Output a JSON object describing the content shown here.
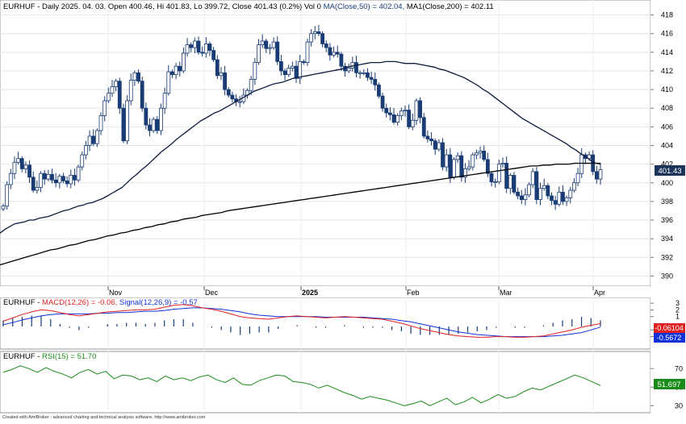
{
  "main": {
    "title_symbol": "EURHUF",
    "title_rest": " - Daily 2025. 04. 03. Open 400.46, Hi 401.83, Lo 399.72, Close 401.43 (0.2%) Vol 0",
    "title_ma50": "MA(Close,50) = 402.04,",
    "title_ma200": "MA1(Close,200) = 402.11",
    "price_badge": "401.43",
    "y_ticks": [
      "390",
      "392",
      "394",
      "396",
      "398",
      "400",
      "402",
      "404",
      "406",
      "408",
      "410",
      "412",
      "414",
      "416",
      "418"
    ],
    "x_labels": [
      "Nov",
      "Dec",
      "2025",
      "Feb",
      "Mar",
      "Apr"
    ]
  },
  "macd": {
    "title_symbol": "EURHUF",
    "title_macd": "MACD(12,26) = -0.06,",
    "title_signal": "Signal(12,26,9) = -0.57",
    "y_ticks": [
      "3",
      "2",
      "1",
      "-1",
      "-2"
    ],
    "badge_macd": "-0.06104",
    "badge_signal": "-0.5672"
  },
  "rsi": {
    "title_symbol": "EURHUF",
    "title_rsi": "RSI(15) = 51.70",
    "y_ticks": [
      "70",
      "50",
      "30"
    ],
    "badge": "51.697"
  },
  "footer": "Created with AmiBroker - advanced charting and technical analysis software. http://www.amibroker.com",
  "colors": {
    "up": "#ffffff",
    "down": "#1a3c74",
    "ma50": "#0d1b3d",
    "ma200": "#000000",
    "macd": "#e02020",
    "signal": "#1030d8",
    "rsi": "#1a8c1a",
    "badge": "#1a3559"
  },
  "chart_data": {
    "type": "candlestick",
    "symbol": "EURHUF",
    "ylim": [
      389,
      419
    ],
    "x_labels": [
      "Nov",
      "Dec",
      "2025",
      "Feb",
      "Mar",
      "Apr"
    ],
    "close": [
      397.5,
      399.8,
      401.0,
      402.2,
      402.6,
      401.5,
      401.9,
      400.6,
      399.2,
      399.5,
      401.0,
      400.4,
      400.9,
      400.3,
      400.0,
      400.7,
      400.2,
      399.9,
      400.8,
      400.3,
      401.7,
      403.0,
      404.0,
      405.0,
      404.2,
      405.6,
      407.2,
      408.8,
      409.6,
      410.3,
      410.9,
      408.0,
      404.5,
      408.8,
      411.0,
      411.8,
      410.9,
      408.0,
      406.2,
      405.6,
      406.8,
      405.6,
      408.0,
      409.6,
      411.9,
      411.6,
      412.5,
      412.0,
      413.9,
      414.8,
      414.5,
      415.2,
      414.0,
      413.9,
      414.9,
      414.2,
      413.2,
      411.5,
      411.8,
      410.0,
      409.4,
      409.0,
      408.7,
      408.7,
      409.4,
      409.9,
      411.1,
      412.9,
      414.8,
      415.2,
      414.4,
      414.5,
      415.1,
      413.0,
      412.0,
      411.6,
      412.3,
      412.5,
      411.2,
      413.0,
      412.9,
      415.1,
      416.0,
      416.2,
      416.0,
      414.9,
      414.5,
      413.7,
      414.0,
      413.8,
      412.5,
      412.0,
      412.3,
      412.9,
      411.8,
      411.8,
      411.8,
      411.3,
      411.1,
      410.5,
      409.3,
      408.0,
      407.5,
      407.3,
      406.5,
      407.2,
      407.7,
      407.8,
      406.0,
      406.7,
      408.8,
      407.0,
      405.0,
      404.7,
      404.5,
      403.6,
      404.3,
      401.7,
      403.0,
      400.6,
      402.5,
      402.9,
      400.6,
      401.5,
      401.7,
      403.0,
      403.2,
      403.4,
      402.5,
      401.0,
      400.1,
      400.1,
      402.0,
      402.1,
      399.4,
      400.8,
      399.0,
      398.6,
      398.2,
      398.7,
      399.8,
      401.2,
      398.2,
      399.4,
      399.7,
      398.6,
      398.1,
      397.7,
      399.0,
      398.0,
      398.4,
      399.2,
      400.0,
      401.0,
      403.0,
      402.6,
      403.0,
      401.2,
      400.4,
      401.4
    ],
    "ma50": [
      394.6,
      395.0,
      395.3,
      395.6,
      395.7,
      395.8,
      396.0,
      396.0,
      396.2,
      396.3,
      396.4,
      396.6,
      396.8,
      397.0,
      397.1,
      397.3,
      397.5,
      397.6,
      397.8,
      397.9,
      398.1,
      398.3,
      398.6,
      398.9,
      399.2,
      399.5,
      400.0,
      400.5,
      400.9,
      401.4,
      401.8,
      402.3,
      402.8,
      403.3,
      403.7,
      404.1,
      404.6,
      405.0,
      405.4,
      405.8,
      406.2,
      406.6,
      406.9,
      407.2,
      407.5,
      407.7,
      408.0,
      408.3,
      408.6,
      408.9,
      409.2,
      409.5,
      409.8,
      410.0,
      410.2,
      410.4,
      410.6,
      410.7,
      410.8,
      411.0,
      411.2,
      411.3,
      411.4,
      411.5,
      411.6,
      411.7,
      411.8,
      411.9,
      412.0,
      412.1,
      412.2,
      412.4,
      412.5,
      412.6,
      412.7,
      412.8,
      412.9,
      412.9,
      412.9,
      413.0,
      413.0,
      413.0,
      412.9,
      412.8,
      412.8,
      412.8,
      412.7,
      412.6,
      412.5,
      412.4,
      412.2,
      412.1,
      411.9,
      411.7,
      411.5,
      411.3,
      411.0,
      410.7,
      410.4,
      410.0,
      409.7,
      409.3,
      408.9,
      408.5,
      408.1,
      407.7,
      407.3,
      406.9,
      406.6,
      406.3,
      406.0,
      405.7,
      405.4,
      405.1,
      404.8,
      404.5,
      404.2,
      403.8,
      403.5,
      403.1,
      402.8,
      402.4,
      402.1,
      402.0
    ],
    "ma200": [
      391.2,
      391.4,
      391.6,
      391.8,
      392.0,
      392.2,
      392.4,
      392.6,
      392.8,
      392.9,
      393.1,
      393.3,
      393.4,
      393.6,
      393.8,
      393.9,
      394.1,
      394.3,
      394.4,
      394.6,
      394.7,
      394.9,
      395.0,
      395.2,
      395.3,
      395.5,
      395.6,
      395.8,
      395.9,
      396.1,
      396.2,
      396.3,
      396.5,
      396.6,
      396.7,
      396.8,
      397.0,
      397.1,
      397.2,
      397.3,
      397.4,
      397.5,
      397.6,
      397.7,
      397.8,
      397.9,
      398.0,
      398.1,
      398.2,
      398.3,
      398.4,
      398.5,
      398.6,
      398.7,
      398.8,
      398.9,
      399.0,
      399.1,
      399.2,
      399.3,
      399.4,
      399.5,
      399.6,
      399.7,
      399.8,
      399.9,
      400.0,
      400.1,
      400.2,
      400.3,
      400.4,
      400.5,
      400.6,
      400.7,
      400.8,
      400.9,
      401.0,
      401.1,
      401.2,
      401.3,
      401.4,
      401.5,
      401.6,
      401.7,
      401.8,
      401.8,
      401.9,
      401.9,
      402.0,
      402.0,
      402.0,
      402.1,
      402.1,
      402.1,
      402.1,
      402.1
    ],
    "macd": [
      0.3,
      0.8,
      1.3,
      1.7,
      2.0,
      1.9,
      1.6,
      1.3,
      1.1,
      1.3,
      1.5,
      1.7,
      1.8,
      1.9,
      2.0,
      2.0,
      2.1,
      2.4,
      2.7,
      2.8,
      2.6,
      2.3,
      2.1,
      1.8,
      1.4,
      1.0,
      0.8,
      0.7,
      0.6,
      0.8,
      1.0,
      1.1,
      1.0,
      0.9,
      0.8,
      0.9,
      1.0,
      0.9,
      0.8,
      0.7,
      0.6,
      0.3,
      0.0,
      -0.4,
      -0.8,
      -1.1,
      -1.4,
      -1.7,
      -1.9,
      -2.0,
      -2.1,
      -2.1,
      -2.0,
      -2.0,
      -2.1,
      -2.1,
      -2.0,
      -1.9,
      -1.6,
      -1.3,
      -1.0,
      -0.6,
      -0.3,
      -0.06
    ],
    "signal": [
      -0.2,
      0.1,
      0.5,
      0.8,
      1.1,
      1.3,
      1.4,
      1.4,
      1.4,
      1.4,
      1.5,
      1.5,
      1.6,
      1.6,
      1.7,
      1.8,
      1.8,
      1.9,
      2.1,
      2.2,
      2.3,
      2.3,
      2.2,
      2.1,
      1.9,
      1.7,
      1.4,
      1.2,
      1.1,
      1.0,
      1.0,
      1.0,
      1.0,
      1.0,
      0.9,
      0.9,
      0.9,
      0.9,
      0.9,
      0.8,
      0.7,
      0.6,
      0.4,
      0.2,
      -0.1,
      -0.4,
      -0.7,
      -1.0,
      -1.3,
      -1.5,
      -1.7,
      -1.8,
      -1.9,
      -2.0,
      -2.0,
      -2.0,
      -2.0,
      -2.0,
      -1.9,
      -1.8,
      -1.6,
      -1.4,
      -1.0,
      -0.57
    ],
    "rsi": [
      66,
      69,
      73,
      70,
      66,
      71,
      67,
      64,
      60,
      66,
      69,
      64,
      67,
      59,
      63,
      62,
      58,
      60,
      56,
      62,
      58,
      60,
      57,
      61,
      63,
      58,
      55,
      60,
      53,
      52,
      57,
      60,
      63,
      62,
      56,
      55,
      53,
      49,
      52,
      48,
      44,
      41,
      37,
      40,
      38,
      36,
      33,
      30,
      32,
      35,
      30,
      34,
      38,
      31,
      34,
      39,
      33,
      37,
      42,
      38,
      40,
      45,
      49,
      47,
      51,
      55,
      59,
      63,
      60,
      56,
      51.7
    ],
    "rsi_ylim": [
      25,
      85
    ]
  }
}
